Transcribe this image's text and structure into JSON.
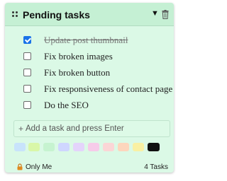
{
  "header": {
    "title": "Pending tasks"
  },
  "tasks": [
    {
      "label": "Update post thumbnail",
      "done": true
    },
    {
      "label": "Fix broken images",
      "done": false
    },
    {
      "label": "Fix broken button",
      "done": false
    },
    {
      "label": "Fix responsiveness of contact page",
      "done": false
    },
    {
      "label": "Do the SEO",
      "done": false
    }
  ],
  "add_task": {
    "placeholder": "Add a task and press Enter",
    "icon": "+"
  },
  "colors": [
    "#c8e3fb",
    "#d9f7a8",
    "#c6f3d0",
    "#cfd6ff",
    "#e4d4fb",
    "#f6cbe9",
    "#fbd6d6",
    "#fdd6bd",
    "#f9f0a3",
    "#111111"
  ],
  "selected_color_index": 9,
  "card_color": "#dbf9e6",
  "footer": {
    "visibility": "Only Me",
    "count": "4 Tasks"
  },
  "icons": [
    "drag-handle-icon",
    "collapse-caret-icon",
    "trash-icon",
    "plus-icon",
    "lock-icon",
    "checkmark-icon"
  ]
}
